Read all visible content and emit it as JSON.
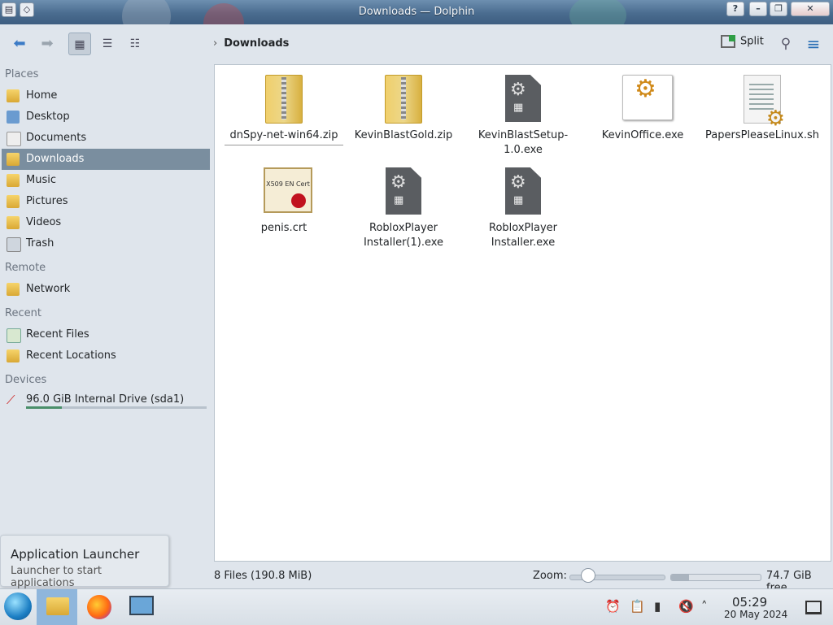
{
  "window": {
    "title": "Downloads — Dolphin"
  },
  "toolbar": {
    "back_icon": "back-arrow-icon",
    "forward_icon": "forward-arrow-icon",
    "breadcrumb": "Downloads",
    "split_label": "Split"
  },
  "sidebar": {
    "sections": [
      "Places",
      "Remote",
      "Recent",
      "Devices"
    ],
    "places": [
      {
        "label": "Home"
      },
      {
        "label": "Desktop"
      },
      {
        "label": "Documents"
      },
      {
        "label": "Downloads"
      },
      {
        "label": "Music"
      },
      {
        "label": "Pictures"
      },
      {
        "label": "Videos"
      },
      {
        "label": "Trash"
      }
    ],
    "remote": [
      {
        "label": "Network"
      }
    ],
    "recent": [
      {
        "label": "Recent Files"
      },
      {
        "label": "Recent Locations"
      }
    ],
    "devices": [
      {
        "label": "96.0 GiB Internal Drive (sda1)",
        "used_fraction": 0.2
      }
    ]
  },
  "files": [
    {
      "name": "dnSpy-net-win64.zip",
      "type": "zip"
    },
    {
      "name": "KevinBlastGold.zip",
      "type": "zip"
    },
    {
      "name": "KevinBlastSetup-1.0.exe",
      "type": "exe"
    },
    {
      "name": "KevinOffice.exe",
      "type": "exe-app"
    },
    {
      "name": "PapersPleaseLinux.sh",
      "type": "script"
    },
    {
      "name": "penis.crt",
      "type": "cert",
      "icon_text": "X509 EN Cert"
    },
    {
      "name": "RobloxPlayer Installer(1).exe",
      "type": "exe"
    },
    {
      "name": "RobloxPlayer Installer.exe",
      "type": "exe"
    }
  ],
  "status": {
    "summary": "8 Files (190.8 MiB)",
    "zoom_label": "Zoom:",
    "zoom_fraction": 0.2,
    "free_space": "74.7 GiB free",
    "used_fraction": 0.2
  },
  "tooltip": {
    "title": "Application Launcher",
    "subtitle": "Launcher to start applications"
  },
  "taskbar": {
    "time": "05:29",
    "date": "20 May 2024"
  }
}
